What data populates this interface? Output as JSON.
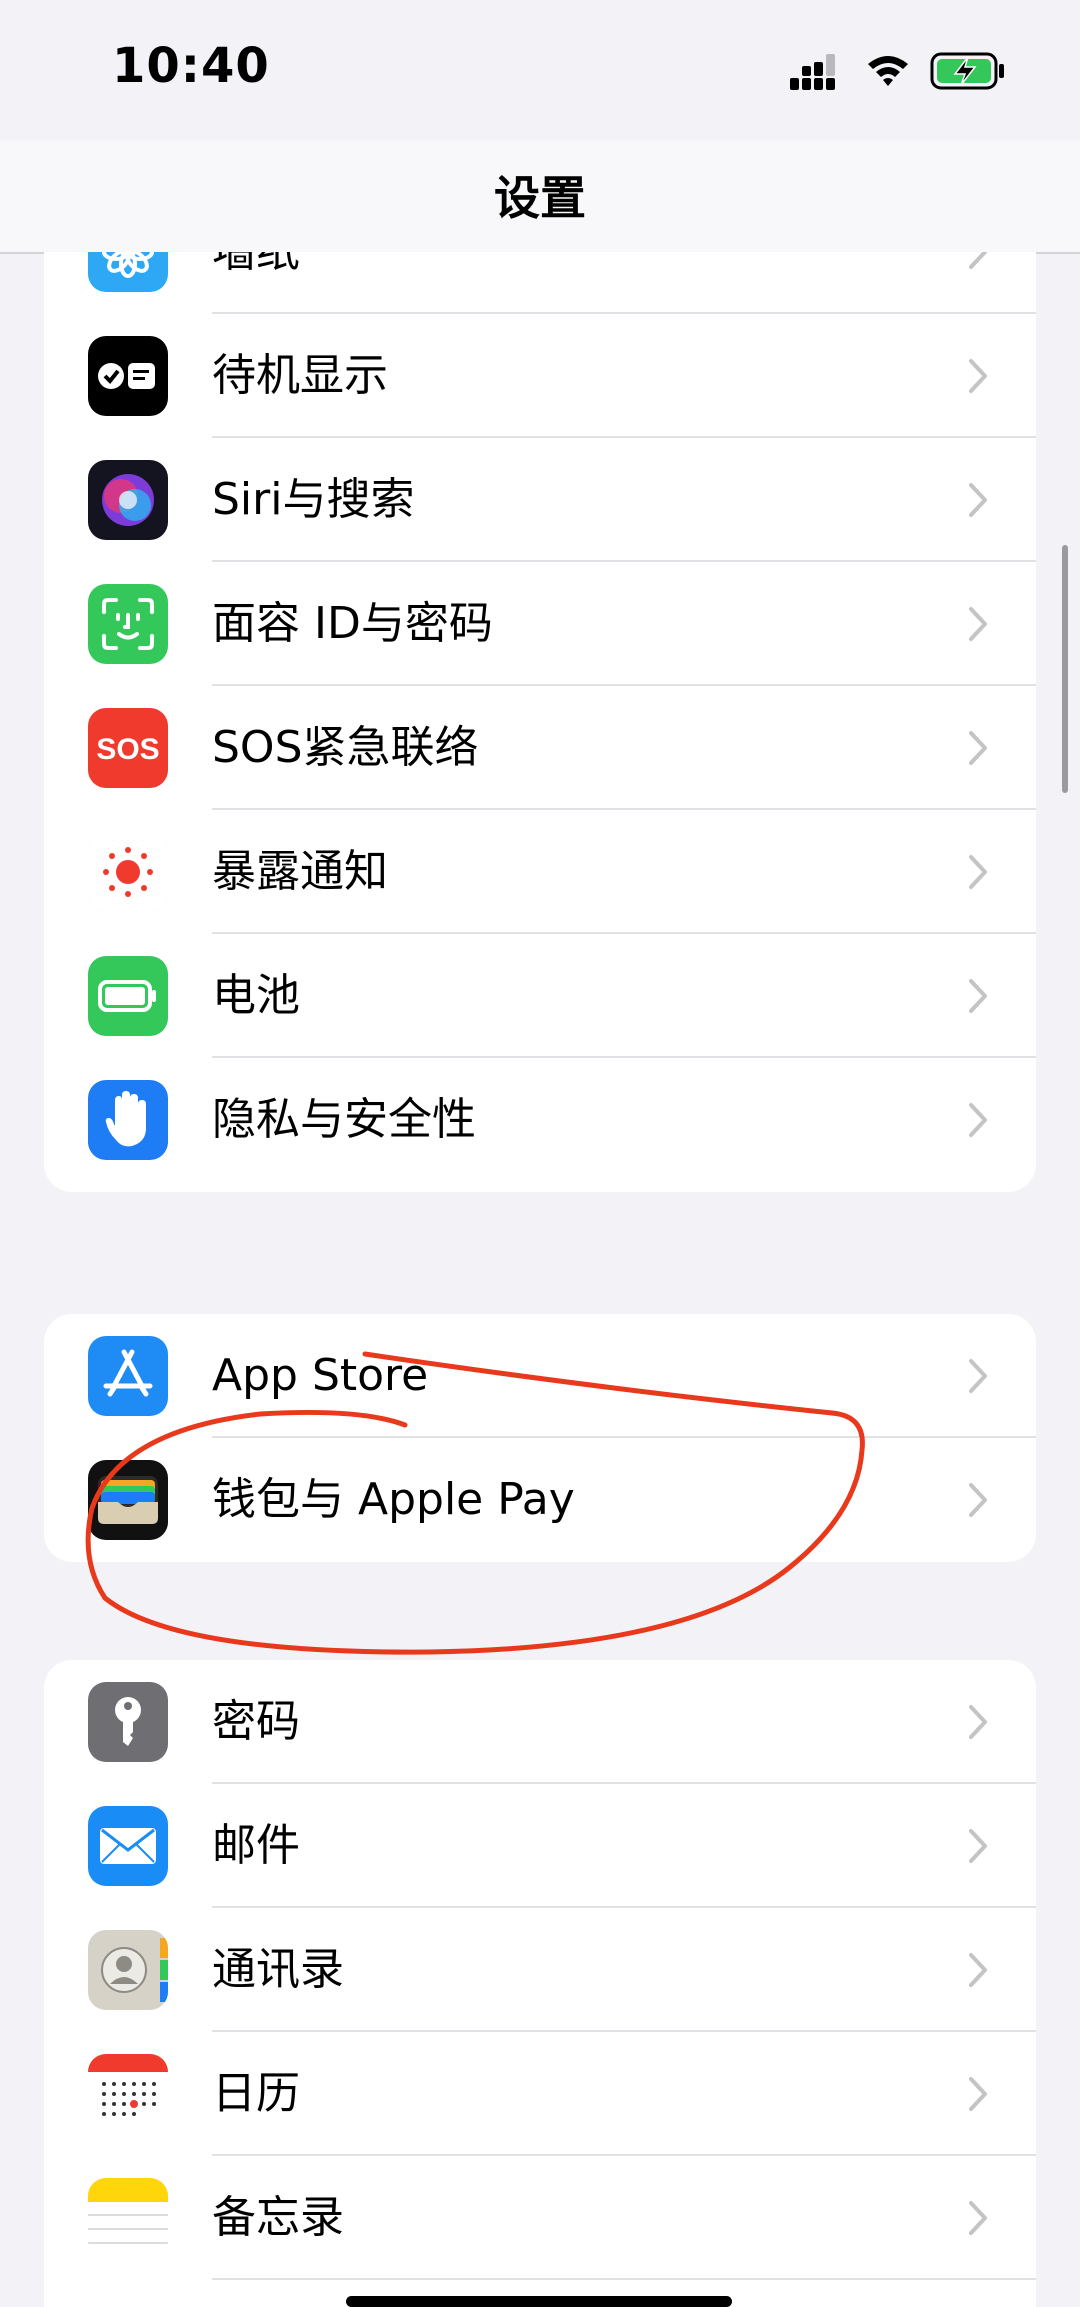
{
  "status_bar": {
    "time": "10:40"
  },
  "nav": {
    "title": "设置"
  },
  "groups": [
    {
      "rows": [
        {
          "label": "墙纸",
          "icon": "wallpaper-icon",
          "color": "#2ea7f5"
        },
        {
          "label": "待机显示",
          "icon": "standby-icon",
          "color": "#000000"
        },
        {
          "label": "Siri与搜索",
          "icon": "siri-icon",
          "color": "#1b1b2e"
        },
        {
          "label": "面容 ID与密码",
          "icon": "face-id-icon",
          "color": "#34c759"
        },
        {
          "label": "SOS紧急联络",
          "icon": "sos-icon",
          "color": "#f03a2e"
        },
        {
          "label": "暴露通知",
          "icon": "exposure-icon",
          "color": "#ffffff"
        },
        {
          "label": "电池",
          "icon": "battery-icon",
          "color": "#34c759"
        },
        {
          "label": "隐私与安全性",
          "icon": "privacy-hand-icon",
          "color": "#1e7cf5"
        }
      ]
    },
    {
      "rows": [
        {
          "label": "App Store",
          "icon": "app-store-icon",
          "color": "#1f8cf5"
        },
        {
          "label": "钱包与 Apple Pay",
          "icon": "wallet-icon",
          "color": "#111111"
        }
      ]
    },
    {
      "rows": [
        {
          "label": "密码",
          "icon": "key-icon",
          "color": "#6e6e73"
        },
        {
          "label": "邮件",
          "icon": "mail-icon",
          "color": "#1a8cf5"
        },
        {
          "label": "通讯录",
          "icon": "contacts-icon",
          "color": "#cfcbc2"
        },
        {
          "label": "日历",
          "icon": "calendar-icon",
          "color": "#ffffff"
        },
        {
          "label": "备忘录",
          "icon": "notes-icon",
          "color": "#ffd60a"
        }
      ]
    }
  ],
  "colors": {
    "annotation": "#e8391d",
    "chevron": "#c4c4c7"
  }
}
